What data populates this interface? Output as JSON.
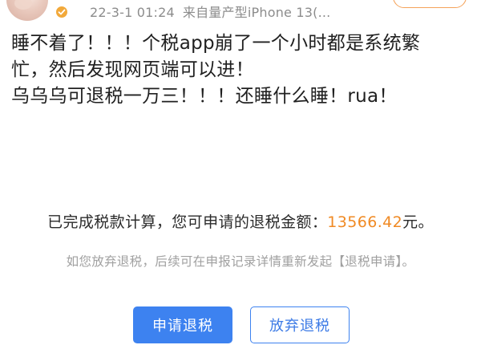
{
  "post": {
    "meta": {
      "timestamp": "22-3-1 01:24",
      "source_prefix": "来自",
      "device": "量产型iPhone 13(..."
    },
    "text_lines": [
      "睡不着了！！！个税app崩了一个小时都是系统繁",
      "忙，然后发现网页端可以进！",
      "乌乌乌可退税一万三！！！还睡什么睡！rua！"
    ]
  },
  "refund": {
    "amount_prefix": "已完成税款计算，您可申请的退税金额：",
    "amount": "13566.42",
    "amount_suffix": "元。",
    "note": "如您放弃退税，后续可在申报记录详情重新发起【退税申请】。",
    "apply_button": "申请退税",
    "waive_button": "放弃退税"
  },
  "colors": {
    "amount": "#f08a24",
    "primary_button": "#3d82f0",
    "meta_text": "#8c8c8c",
    "note_text": "#a0a0a0",
    "verified_badge": "#f2a93b"
  },
  "icons": {
    "verified": "verified-badge-icon",
    "avatar": "avatar"
  }
}
